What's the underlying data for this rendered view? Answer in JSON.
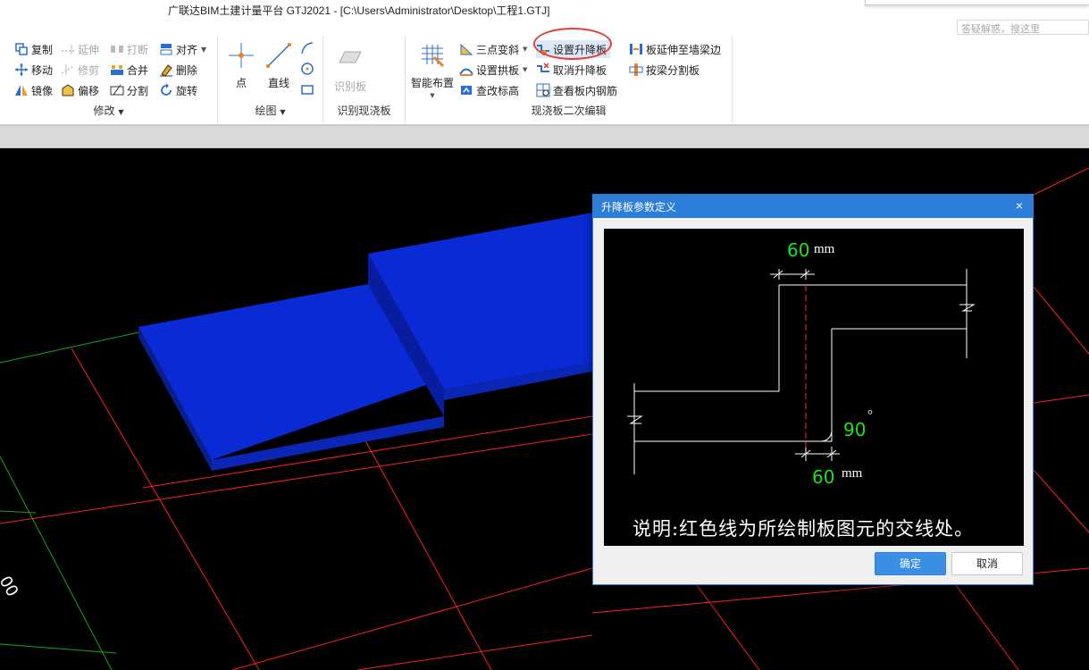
{
  "window": {
    "title": "广联达BIM土建计量平台 GTJ2021 - [C:\\Users\\Administrator\\Desktop\\工程1.GTJ]",
    "help_search_placeholder": "答疑解惑，搜这里"
  },
  "ribbon": {
    "modify": {
      "label": "修改",
      "copy": "复制",
      "extend": "延伸",
      "break": "打断",
      "align": "对齐",
      "move": "移动",
      "trim": "修剪",
      "merge": "合并",
      "delete": "删除",
      "mirror": "镜像",
      "offset": "偏移",
      "split": "分割",
      "rotate": "旋转"
    },
    "draw": {
      "label": "绘图",
      "point": "点",
      "line": "直线"
    },
    "identify": {
      "label": "识别现浇板",
      "identify_slab": "识别板"
    },
    "slab_edit": {
      "label": "现浇板二次编辑",
      "smart_layout": "智能布置",
      "three_point_slope": "三点变斜",
      "set_arch_slab": "设置拱板",
      "modify_elevation": "查改标高",
      "set_drop_slab": "设置升降板",
      "cancel_drop_slab": "取消升降板",
      "view_slab_rebar": "查看板内钢筋",
      "extend_slab_to_wall_beam": "板延伸至墙梁边",
      "split_by_beam": "按梁分割板"
    }
  },
  "viewport": {
    "label": "00"
  },
  "dialog": {
    "title": "升降板参数定义",
    "close_glyph": "×",
    "diagram": {
      "top_dimension": "60",
      "top_unit": "mm",
      "bottom_dimension": "60",
      "bottom_unit": "mm",
      "angle": "90",
      "angle_unit": "°",
      "note": "说明:红色线为所绘制板图元的交线处。"
    },
    "ok_label": "确定",
    "cancel_label": "取消"
  },
  "colors": {
    "accent": "#2d7ed8",
    "slab": "#0a2ad6",
    "grid_red": "#ff2020",
    "grid_green": "#17a317",
    "dim_green": "#1ee11e"
  }
}
